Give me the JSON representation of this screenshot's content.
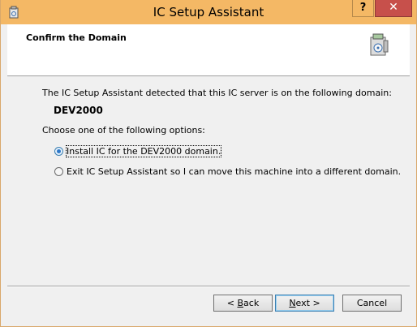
{
  "window": {
    "title": "IC Setup Assistant",
    "help_label": "?",
    "close_label": "✕"
  },
  "header": {
    "title": "Confirm the Domain"
  },
  "main": {
    "detected_text": "The IC Setup Assistant detected that this IC server is on the following domain:",
    "domain": "DEV2000",
    "choose_text": "Choose one of the following options:",
    "options": [
      {
        "label": "Install IC for the DEV2000 domain.",
        "selected": true
      },
      {
        "label": "Exit IC Setup Assistant so I can move this machine into a different domain.",
        "selected": false
      }
    ]
  },
  "buttons": {
    "back_prefix": "< ",
    "back_mnemonic": "B",
    "back_suffix": "ack",
    "next_mnemonic": "N",
    "next_suffix": "ext >",
    "cancel": "Cancel"
  },
  "colors": {
    "titlebar": "#f4b865",
    "close_button": "#c7504b",
    "radio_selected": "#2e78c8"
  },
  "icons": {
    "app": "installer-icon",
    "header": "setup-box-icon"
  }
}
